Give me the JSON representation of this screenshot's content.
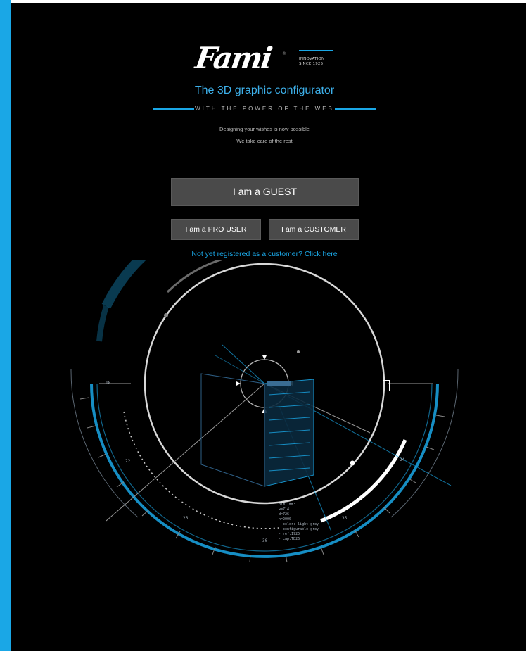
{
  "brand": {
    "logo_text": "Fami",
    "registered": "®",
    "tagline_lines": [
      "INNOVATION",
      "SINCE 1925"
    ]
  },
  "header": {
    "title": "The 3D graphic configurator",
    "subtitle": "WITH THE POWER OF THE WEB",
    "intro_lines": [
      "Designing your wishes is now possible",
      "We take care of the rest"
    ]
  },
  "actions": {
    "guest_label": "I am a GUEST",
    "pro_user_label": "I am a PRO USER",
    "customer_label": "I am a CUSTOMER",
    "register_link": "Not yet registered as a customer? Click here"
  },
  "hud": {
    "spec_lines": [
      "dim. mm:",
      "w=714",
      "d=726",
      "h=2000",
      "- color: light grey",
      "- configurable grey",
      "- ref.1925",
      "- cap.TD26"
    ],
    "scale_labels": [
      "30",
      "26",
      "22",
      "18",
      "35",
      "24"
    ]
  },
  "colors": {
    "accent": "#1aa7e6",
    "button_bg": "#4a4a4a",
    "background": "#000000"
  },
  "icons": [
    "hud-reticle-icon",
    "cabinet-wireframe-icon"
  ]
}
